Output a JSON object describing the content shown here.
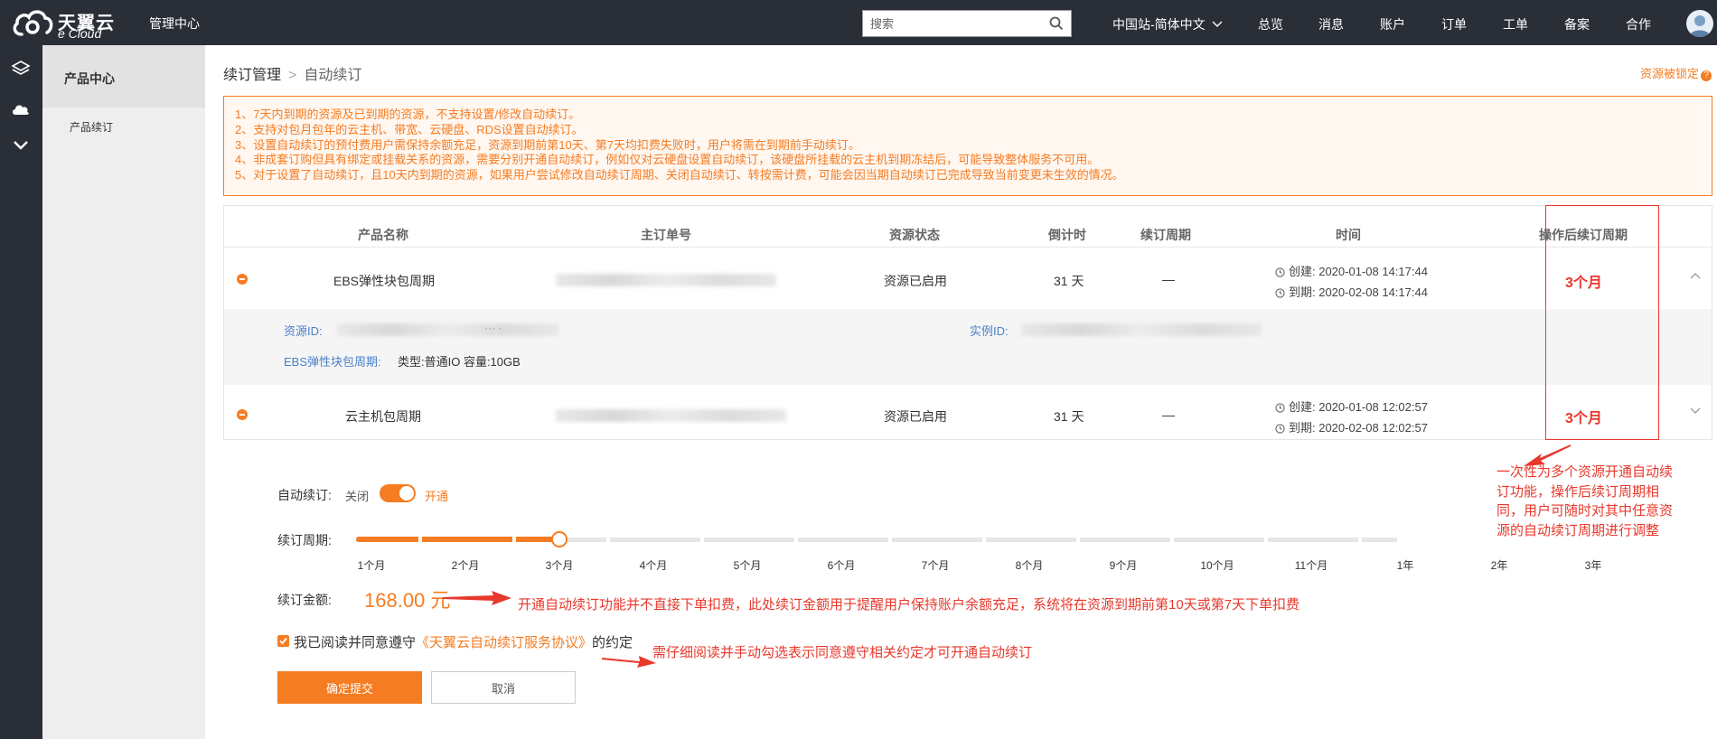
{
  "topbar": {
    "brand_cn": "天翼云",
    "brand_en": "e Cloud",
    "title": "管理中心",
    "search_placeholder": "搜索",
    "nav": [
      {
        "label": "中国站-简体中文"
      },
      {
        "label": "总览"
      },
      {
        "label": "消息"
      },
      {
        "label": "账户"
      },
      {
        "label": "订单"
      },
      {
        "label": "工单"
      },
      {
        "label": "备案"
      },
      {
        "label": "合作"
      }
    ]
  },
  "sidebar": {
    "title": "产品中心",
    "items": [
      {
        "label": "产品续订"
      }
    ]
  },
  "breadcrumb": {
    "parent": "续订管理",
    "current": "自动续订"
  },
  "locked_link": "资源被锁定",
  "notice": [
    "1、7天内到期的资源及已到期的资源，不支持设置/修改自动续订。",
    "2、支持对包月包年的云主机、带宽、云硬盘、RDS设置自动续订。",
    "3、设置自动续订的预付费用户需保持余额充足，资源到期前第10天、第7天均扣费失败时，用户将需在到期前手动续订。",
    "4、非成套订购但具有绑定或挂载关系的资源，需要分别开通自动续订，例如仅对云硬盘设置自动续订，该硬盘所挂载的云主机到期冻结后，可能导致整体服务不可用。",
    "5、对于设置了自动续订，且10天内到期的资源，如果用户尝试修改自动续订周期、关闭自动续订、转按需计费，可能会因当期自动续订已完成导致当前变更未生效的情况。"
  ],
  "table": {
    "headers": {
      "product": "产品名称",
      "order": "主订单号",
      "status": "资源状态",
      "countdown": "倒计时",
      "period": "续订周期",
      "time": "时间",
      "after": "操作后续订周期"
    },
    "rows": [
      {
        "product": "EBS弹性块包周期",
        "status": "资源已启用",
        "countdown": "31 天",
        "period": "—",
        "created": "创建: 2020-01-08 14:17:44",
        "expires": "到期: 2020-02-08 14:17:44",
        "after": "3个月"
      },
      {
        "product": "云主机包周期",
        "status": "资源已启用",
        "countdown": "31 天",
        "period": "—",
        "created": "创建: 2020-01-08 12:02:57",
        "expires": "到期: 2020-02-08 12:02:57",
        "after": "3个月"
      }
    ],
    "detail": {
      "resource_id_label": "资源ID:",
      "resource_id_tail": "··· ·",
      "instance_id_label": "实例ID:",
      "spec_label": "EBS弹性块包周期:",
      "spec_value": "类型:普通IO 容量:10GB"
    }
  },
  "form": {
    "auto_label": "自动续订:",
    "off_label": "关闭",
    "on_label": "开通",
    "toggle_on": true,
    "period_label": "续订周期:",
    "period_options": [
      "1个月",
      "2个月",
      "3个月",
      "4个月",
      "5个月",
      "6个月",
      "7个月",
      "8个月",
      "9个月",
      "10个月",
      "11个月",
      "1年",
      "2年",
      "3年"
    ],
    "period_selected_index": 2,
    "amount_label": "续订金额:",
    "amount_value": "168.00 元",
    "agree_checked": true,
    "agree_prefix": "我已阅读并同意遵守",
    "agree_link": "《天翼云自动续订服务协议》",
    "agree_suffix": "的约定",
    "submit_label": "确定提交",
    "cancel_label": "取消"
  },
  "annotations": {
    "amount_note": "开通自动续订功能并不直接下单扣费，此处续订金额用于提醒用户保持账户余额充足，系统将在资源到期前第10天或第7天下单扣费",
    "agree_note": "需仔细阅读并手动勾选表示同意遵守相关约定才可开通自动续订",
    "side_note": "一次性为多个资源开通自动续订功能，操作后续订周期相同，用户可随时对其中任意资源的自动续订周期进行调整"
  },
  "colors": {
    "accent": "#f57c22",
    "annotation": "#e8382c",
    "topbar": "#2a2e36",
    "link_blue": "#4a7fc9"
  }
}
